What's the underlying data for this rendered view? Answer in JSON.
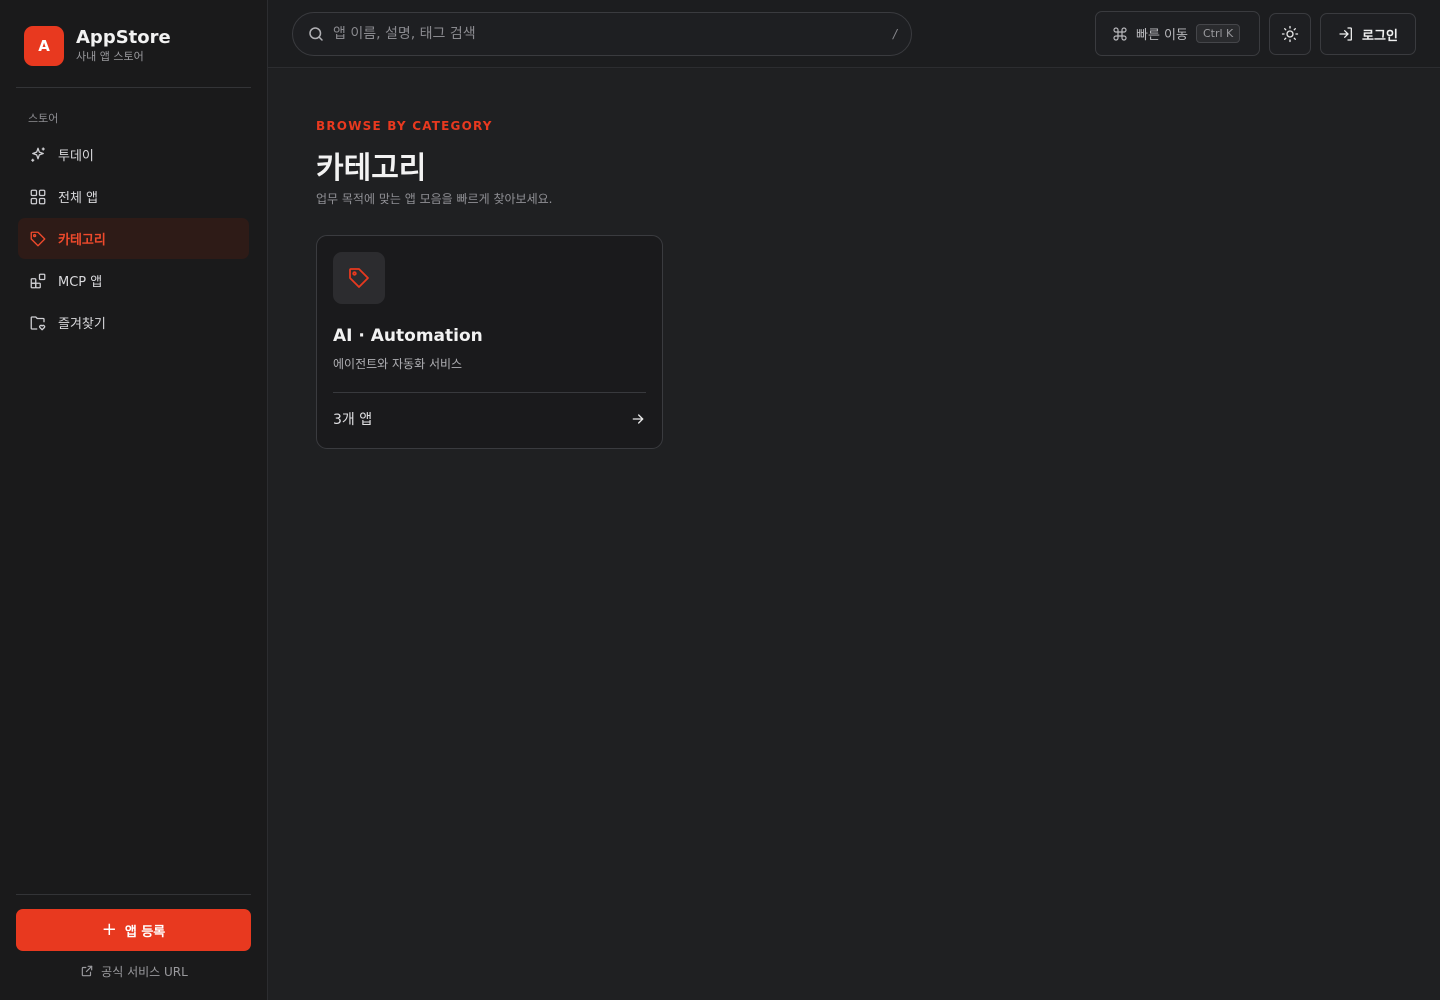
{
  "brand": {
    "logo_letter": "A",
    "name": "AppStore",
    "subtitle": "사내 앱 스토어",
    "accent": "#e8391f"
  },
  "sidebar": {
    "section_label": "스토어",
    "items": [
      {
        "label": "투데이",
        "icon": "sparkles-icon",
        "active": false
      },
      {
        "label": "전체 앱",
        "icon": "grid-icon",
        "active": false
      },
      {
        "label": "카테고리",
        "icon": "tag-icon",
        "active": true
      },
      {
        "label": "MCP 앱",
        "icon": "blocks-icon",
        "active": false
      },
      {
        "label": "즐겨찾기",
        "icon": "folder-heart-icon",
        "active": false
      }
    ],
    "register_button": {
      "icon": "+",
      "label": "앱 등록"
    },
    "official_link": {
      "icon": "external-link-icon",
      "label": "공식 서비스 URL"
    }
  },
  "header": {
    "search": {
      "placeholder": "앱 이름, 설명, 태그 검색",
      "shortcut": "/"
    },
    "quick_nav": {
      "label": "빠른 이동",
      "shortcut": "Ctrl K"
    },
    "theme_toggle": {
      "icon": "sun-icon"
    },
    "login": {
      "label": "로그인",
      "icon": "log-in-icon"
    }
  },
  "main": {
    "eyebrow": "BROWSE BY CATEGORY",
    "title": "카테고리",
    "description": "업무 목적에 맞는 앱 모음을 빠르게 찾아보세요.",
    "categories": [
      {
        "title": "AI · Automation",
        "description": "에이전트와 자동화 서비스",
        "count_label": "3개 앱",
        "icon": "tag-icon"
      }
    ]
  }
}
